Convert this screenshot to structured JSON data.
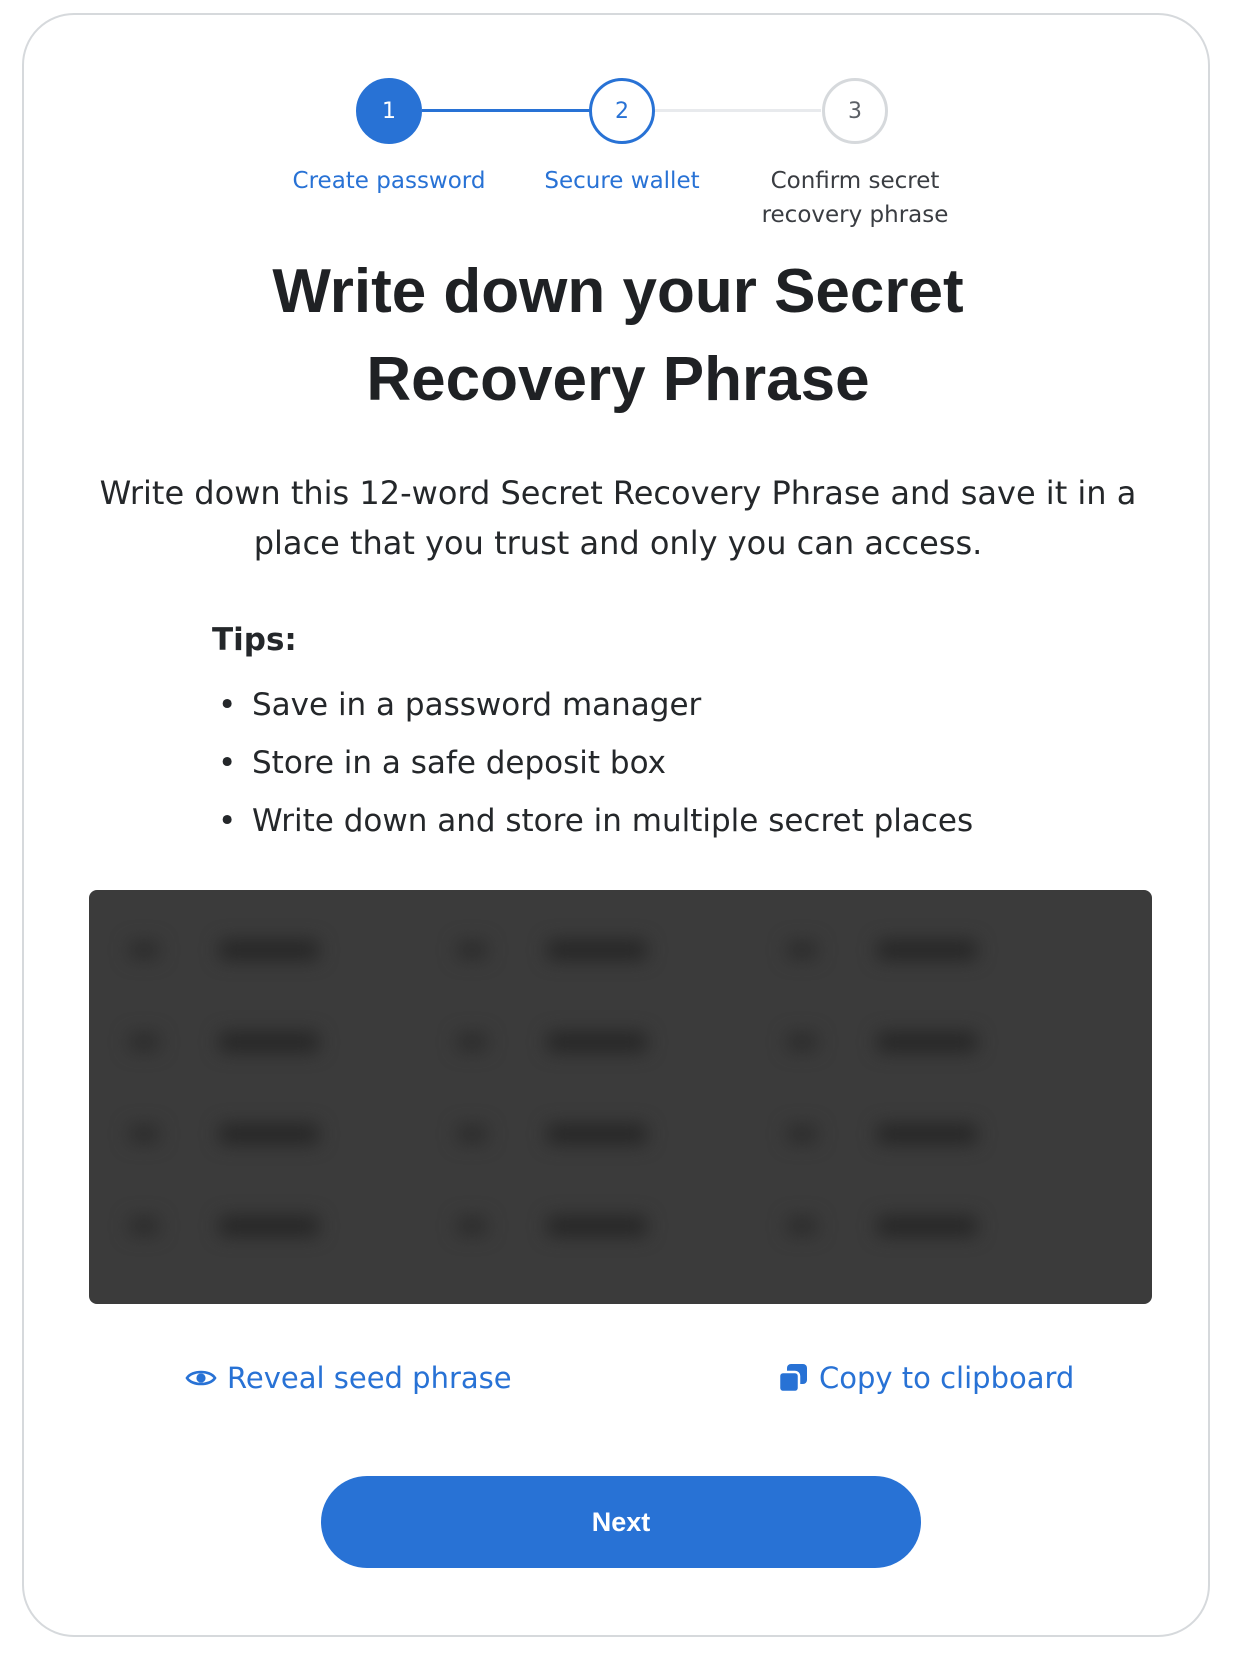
{
  "stepper": {
    "steps": [
      {
        "number": "1",
        "label": "Create password",
        "state": "complete"
      },
      {
        "number": "2",
        "label": "Secure wallet",
        "state": "active"
      },
      {
        "number": "3",
        "label_line1": "Confirm secret",
        "label_line2": "recovery phrase",
        "state": "pending"
      }
    ]
  },
  "heading": {
    "line1": "Write down your Secret",
    "line2": "Recovery Phrase"
  },
  "description": {
    "line1": "Write down this 12-word Secret Recovery Phrase and save it in a",
    "line2": "place that you trust and only you can access."
  },
  "tips": {
    "title": "Tips:",
    "items": [
      "Save in a password manager",
      "Store in a safe deposit box",
      "Write down and store in multiple secret places"
    ]
  },
  "seed_phrase": {
    "state": "hidden"
  },
  "actions": {
    "reveal_label": "Reveal seed phrase",
    "reveal_icon": "eye-icon",
    "copy_label": "Copy to clipboard",
    "copy_icon": "copy-icon"
  },
  "next_button": {
    "label": "Next"
  },
  "colors": {
    "accent": "#2872d5",
    "seed_box_bg": "#3b3b3b",
    "border": "#d6d9dc",
    "text": "#24272a"
  }
}
